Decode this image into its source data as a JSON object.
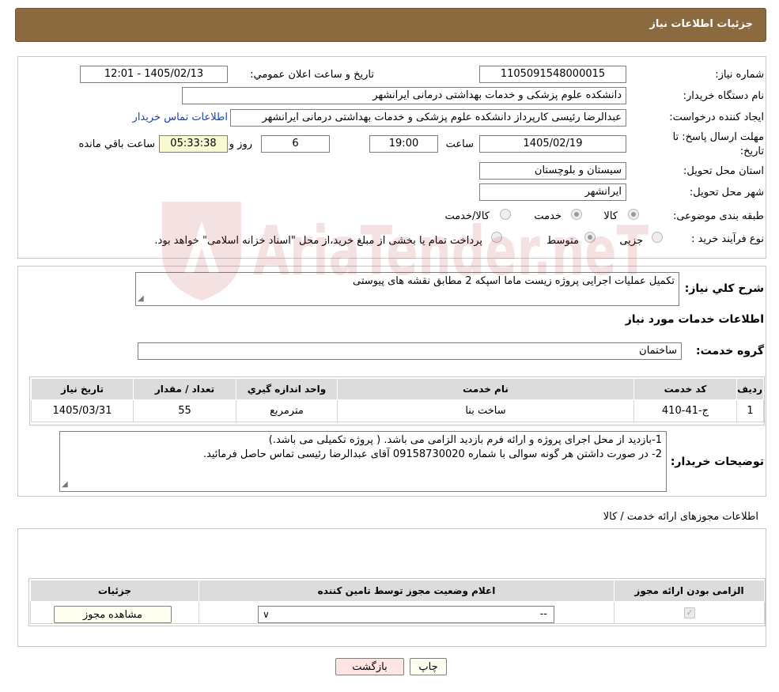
{
  "header": {
    "title": "جزئیات اطلاعات نیاز"
  },
  "form": {
    "need_number_label": "شماره نیاز:",
    "need_number": "1105091548000015",
    "announce_label": "تاریخ و ساعت اعلان عمومي:",
    "announce_value": "1405/02/13 - 12:01",
    "buyer_org_label": "نام دستگاه خريدار:",
    "buyer_org": "دانشکده علوم پزشکی و خدمات بهداشتی درمانی ایرانشهر",
    "creator_label": "ایجاد کننده درخواست:",
    "creator": "عبدالرضا رئیسی کارپرداز دانشکده علوم پزشکی و خدمات بهداشتی درمانی ایرانشهر",
    "contact_link": "اطلاعات تماس خريدار",
    "deadline_label": "مهلت ارسال پاسخ: تا تاریخ:",
    "deadline_date": "1405/02/19",
    "time_label": "ساعت",
    "deadline_time": "19:00",
    "days_value": "6",
    "days_label": "روز و",
    "remaining_time": "05:33:38",
    "remaining_label": "ساعت باقي مانده",
    "province_label": "استان محل تحویل:",
    "province": "سیستان و بلوچستان",
    "city_label": "شهر محل تحویل:",
    "city": "ایرانشهر",
    "category_label": "طبقه بندی موضوعی:",
    "category_options": [
      "کالا",
      "خدمت",
      "کالا/خدمت"
    ],
    "process_label": "نوع فرآیند خرید :",
    "process_options": [
      "جزیی",
      "متوسط"
    ],
    "process_note": "پرداخت تمام یا بخشی از مبلغ خرید،از محل \"اسناد خزانه اسلامی\" خواهد بود."
  },
  "summary": {
    "label": "شرح کلي نياز:",
    "value": "تکمیل عملیات اجرایی پروژه زیست ماما اسپکه 2 مطابق نقشه های پیوستی"
  },
  "services": {
    "section_title": "اطلاعات خدمات مورد نياز",
    "group_label": "گروه خدمت:",
    "group_value": "ساختمان",
    "columns": [
      "رديف",
      "کد خدمت",
      "نام خدمت",
      "واحد اندازه گيري",
      "تعداد / مقدار",
      "تاريخ نياز"
    ],
    "rows": [
      [
        "1",
        "ج-41-410",
        "ساخت بنا",
        "مترمربع",
        "55",
        "1405/03/31"
      ]
    ]
  },
  "buyer_notes": {
    "label": "توضيحات خريدار:",
    "value": "1-بازدید از محل اجرای پروژه و ارائه فرم بازدید الزامی می باشد. ( پروژه تکمیلی می باشد.)\n2- در صورت داشتن هر گونه سوالی با شماره 09158730020 آقای عبدالرضا رئیسی تماس حاصل فرمائید."
  },
  "licenses": {
    "section_title": "اطلاعات مجوزهای ارائه خدمت / کالا",
    "columns": [
      "الزامی بودن ارائه مجوز",
      "اعلام وضعیت مجوز توسط تامین کننده",
      "جزئیات"
    ],
    "select_value": "--",
    "view_button": "مشاهده مجوز"
  },
  "actions": {
    "print_label": "چاپ",
    "back_label": "بازگشت"
  },
  "watermark": {
    "text": "AriaTender.neT"
  }
}
